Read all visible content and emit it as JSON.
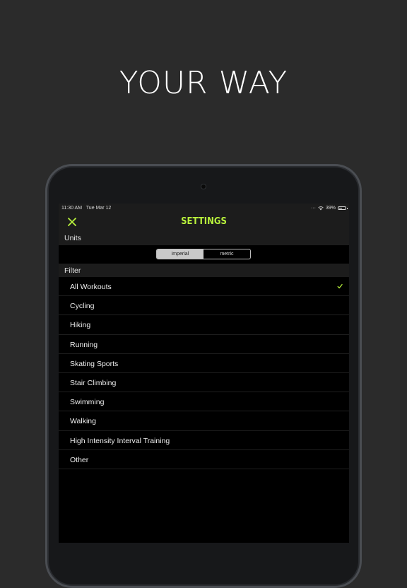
{
  "headline": "YOUR WAY",
  "status_bar": {
    "time": "11:30 AM",
    "date": "Tue Mar 12",
    "battery": "39%"
  },
  "nav": {
    "title": "SETTINGS"
  },
  "units": {
    "header": "Units",
    "options": [
      "imperial",
      "metric"
    ],
    "selected": "imperial"
  },
  "filter": {
    "header": "Filter",
    "items": [
      "All Workouts",
      "Cycling",
      "Hiking",
      "Running",
      "Skating Sports",
      "Stair Climbing",
      "Swimming",
      "Walking",
      "High Intensity Interval Training",
      "Other"
    ],
    "selected": "All Workouts"
  },
  "colors": {
    "accent": "#b8f23c",
    "background": "#2b2b2b",
    "screen": "#000000"
  }
}
